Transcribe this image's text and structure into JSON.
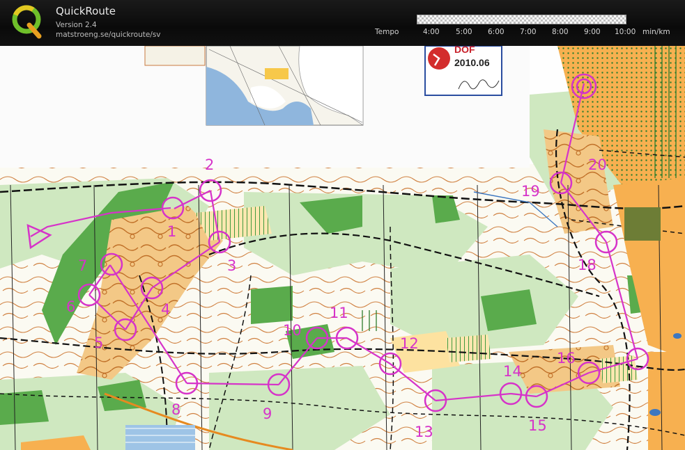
{
  "app": {
    "title": "QuickRoute",
    "version": "Version 2.4",
    "url": "matstroeng.se/quickroute/sv",
    "logo_icon": "quickroute-q-logo-icon"
  },
  "pace_scale": {
    "label": "Tempo",
    "ticks": [
      "4:00",
      "5:00",
      "6:00",
      "7:00",
      "8:00",
      "9:00",
      "10:00"
    ],
    "unit": "min/km"
  },
  "map": {
    "badge": {
      "title": "DOF",
      "date": "2010.06"
    },
    "control_labels": [
      "1",
      "2",
      "3",
      "4",
      "5",
      "6",
      "7",
      "8",
      "9",
      "10",
      "11",
      "12",
      "13",
      "14",
      "15",
      "16",
      "18",
      "19",
      "20"
    ],
    "colors": {
      "course": "#d633c9",
      "forest_dark": "#3e9a3e",
      "forest_light": "#c8e6b9",
      "open_land": "#f6b55a",
      "rough_open": "#fde2a0",
      "contour": "#c8702a",
      "water": "#3d77c0"
    }
  }
}
